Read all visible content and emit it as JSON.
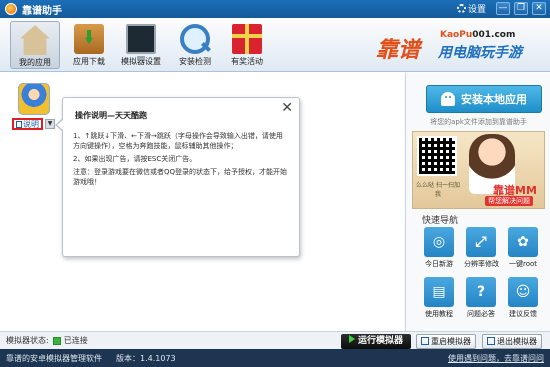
{
  "window": {
    "title": "靠谱助手",
    "settings_label": "设置",
    "controls": {
      "minimize": "—",
      "restore": "❐",
      "close": "✕"
    }
  },
  "toolbar": {
    "items": [
      {
        "label": "我的应用",
        "icon": "house-icon",
        "active": true
      },
      {
        "label": "应用下载",
        "icon": "download-box-icon"
      },
      {
        "label": "模拟器设置",
        "icon": "monitor-icon"
      },
      {
        "label": "安装检测",
        "icon": "magnifier-icon"
      },
      {
        "label": "有奖活动",
        "icon": "gift-icon"
      }
    ],
    "brand": {
      "cn": "靠谱",
      "url_prefix": "KaoPu",
      "url_suffix": "001.com",
      "slogan": "用电脑玩手游"
    }
  },
  "app": {
    "label": "说明",
    "icon": "game-avatar-icon"
  },
  "popup": {
    "title": "操作说明—天天酷跑",
    "line1": "1、↑跳跃↓下滑、←下滑→跳跃（字母操作会导致输入出错，请使用方向键操作），空格为奔跑技能，鼠标辅助其他操作；",
    "line2": "2、如果出现广告，请按ESC关闭广告。",
    "line3": "注意：登录游戏要在微信或者QQ登录的状态下，给予授权，才能开始游戏哦！",
    "close": "✕"
  },
  "right": {
    "install_label": "安装本地应用",
    "install_hint": "将您的apk文件添加到靠谱助手",
    "ad": {
      "qr_caption": "么么哒 扫一扫加我",
      "title": "靠谱MM",
      "subtitle": "帮您解决问题"
    },
    "nav_title": "快速导航",
    "nav": [
      {
        "label": "今日新游",
        "icon": "gamepad-icon",
        "glyph": "◎"
      },
      {
        "label": "分辨率修改",
        "icon": "resize-icon",
        "glyph": "⤢"
      },
      {
        "label": "一键root",
        "icon": "root-icon",
        "glyph": "✿"
      },
      {
        "label": "使用教程",
        "icon": "book-icon",
        "glyph": "▤"
      },
      {
        "label": "问题必答",
        "icon": "question-icon",
        "glyph": "?"
      },
      {
        "label": "建议反馈",
        "icon": "feedback-icon",
        "glyph": "☺"
      }
    ]
  },
  "statusbar": {
    "label": "模拟器状态:",
    "value": "已连接",
    "run": "运行模拟器",
    "restart": "重启模拟器",
    "exit": "退出模拟器"
  },
  "footer": {
    "name": "靠谱的安卓模拟器管理软件",
    "version": "版本：1.4.1073",
    "link": "使用遇到问题，去靠谱问问"
  },
  "colors": {
    "titlebar": "#1b6fb8",
    "accent": "#2585c4",
    "brand": "#e0501b",
    "footer": "#1d3550"
  }
}
